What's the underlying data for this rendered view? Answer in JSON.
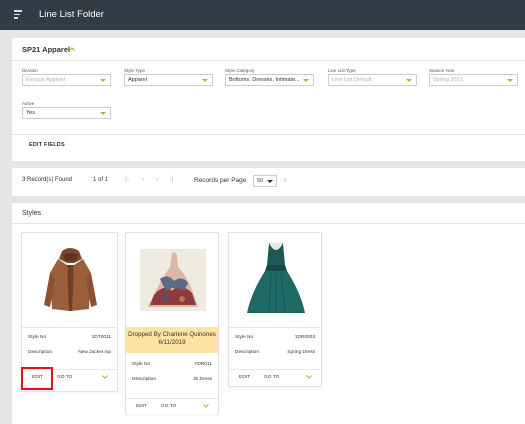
{
  "app": {
    "title": "Line List Folder",
    "menu_icon": "hamburger-icon"
  },
  "folder": {
    "name": "SP21 Apparel",
    "toggle_icon": "chevron-up-icon"
  },
  "fields": [
    {
      "label": "Division",
      "value": "Evoque Apparel",
      "disabled": true
    },
    {
      "label": "Style Type",
      "value": "Apparel",
      "disabled": false
    },
    {
      "label": "Style Category",
      "value": "Bottoms, Dresses, Intimate...",
      "disabled": false
    },
    {
      "label": "Line List Type",
      "value": "Line List Default",
      "disabled": true
    },
    {
      "label": "Season Year",
      "value": "Spring 2021",
      "disabled": true
    },
    {
      "label": "Active",
      "value": "Yes",
      "disabled": false
    }
  ],
  "edit_fields_label": "EDIT FIELDS",
  "pagination": {
    "records_found": "3 Record(s) Found",
    "page_of": "1 of 1",
    "first": "|‹",
    "prev": "‹",
    "next_disabled": "›",
    "last": "›|",
    "rpp_label": "Records per Page",
    "rpp_value": "50",
    "next_icon": "›"
  },
  "styles": {
    "title": "Styles",
    "cards": [
      {
        "style_no_label": "Style No",
        "style_no": "1DT0011",
        "desc_label": "Description",
        "description": "New Jacket mp",
        "edit": "EDIT",
        "goto": "GO TO",
        "image": "leather-jacket-image",
        "banner": ""
      },
      {
        "style_no_label": "Style No",
        "style_no": "YDR011",
        "desc_label": "Description",
        "description": "Jb Dress",
        "edit": "EDIT",
        "goto": "GO TO",
        "image": "floral-gown-image",
        "banner": "Dropped By Charlene Quinones 6/11/2019"
      },
      {
        "style_no_label": "Style No",
        "style_no": "1DR0003",
        "desc_label": "Description",
        "description": "Spring Dress",
        "edit": "EDIT",
        "goto": "GO TO",
        "image": "teal-dress-image",
        "banner": ""
      }
    ]
  },
  "colors": {
    "topbar": "#323c46",
    "accent": "#a8b53a",
    "banner": "#fde4a4",
    "highlight": "#e0141e"
  }
}
